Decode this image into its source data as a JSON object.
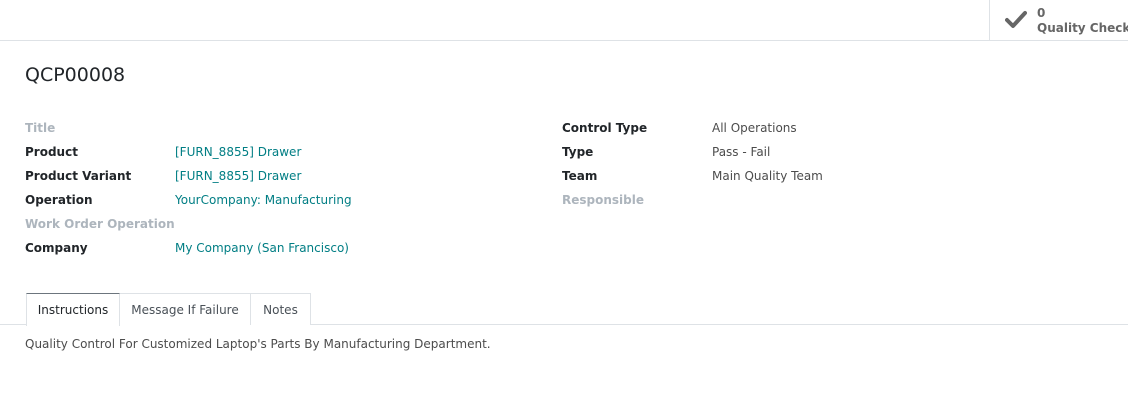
{
  "smart_button": {
    "value": "0",
    "label": "Quality Checks",
    "icon": "check-icon"
  },
  "record": {
    "name": "QCP00008"
  },
  "left_fields": [
    {
      "label": "Title",
      "value": ""
    },
    {
      "label": "Product",
      "value": "[FURN_8855] Drawer"
    },
    {
      "label": "Product Variant",
      "value": "[FURN_8855] Drawer"
    },
    {
      "label": "Operation",
      "value": "YourCompany: Manufacturing"
    },
    {
      "label": "Work Order Operation",
      "value": ""
    },
    {
      "label": "Company",
      "value": "My Company (San Francisco)"
    }
  ],
  "right_fields": [
    {
      "label": "Control Type",
      "value": "All Operations"
    },
    {
      "label": "Type",
      "value": "Pass - Fail"
    },
    {
      "label": "Team",
      "value": "Main Quality Team"
    },
    {
      "label": "Responsible",
      "value": ""
    }
  ],
  "tabs": [
    {
      "label": "Instructions",
      "active": true
    },
    {
      "label": "Message If Failure",
      "active": false
    },
    {
      "label": "Notes",
      "active": false
    }
  ],
  "tab_content": {
    "text": "Quality Control For Customized Laptop's Parts By Manufacturing Department."
  },
  "colors": {
    "link": "#017e84",
    "muted_label": "#adb5bd",
    "border": "#dee2e6"
  }
}
